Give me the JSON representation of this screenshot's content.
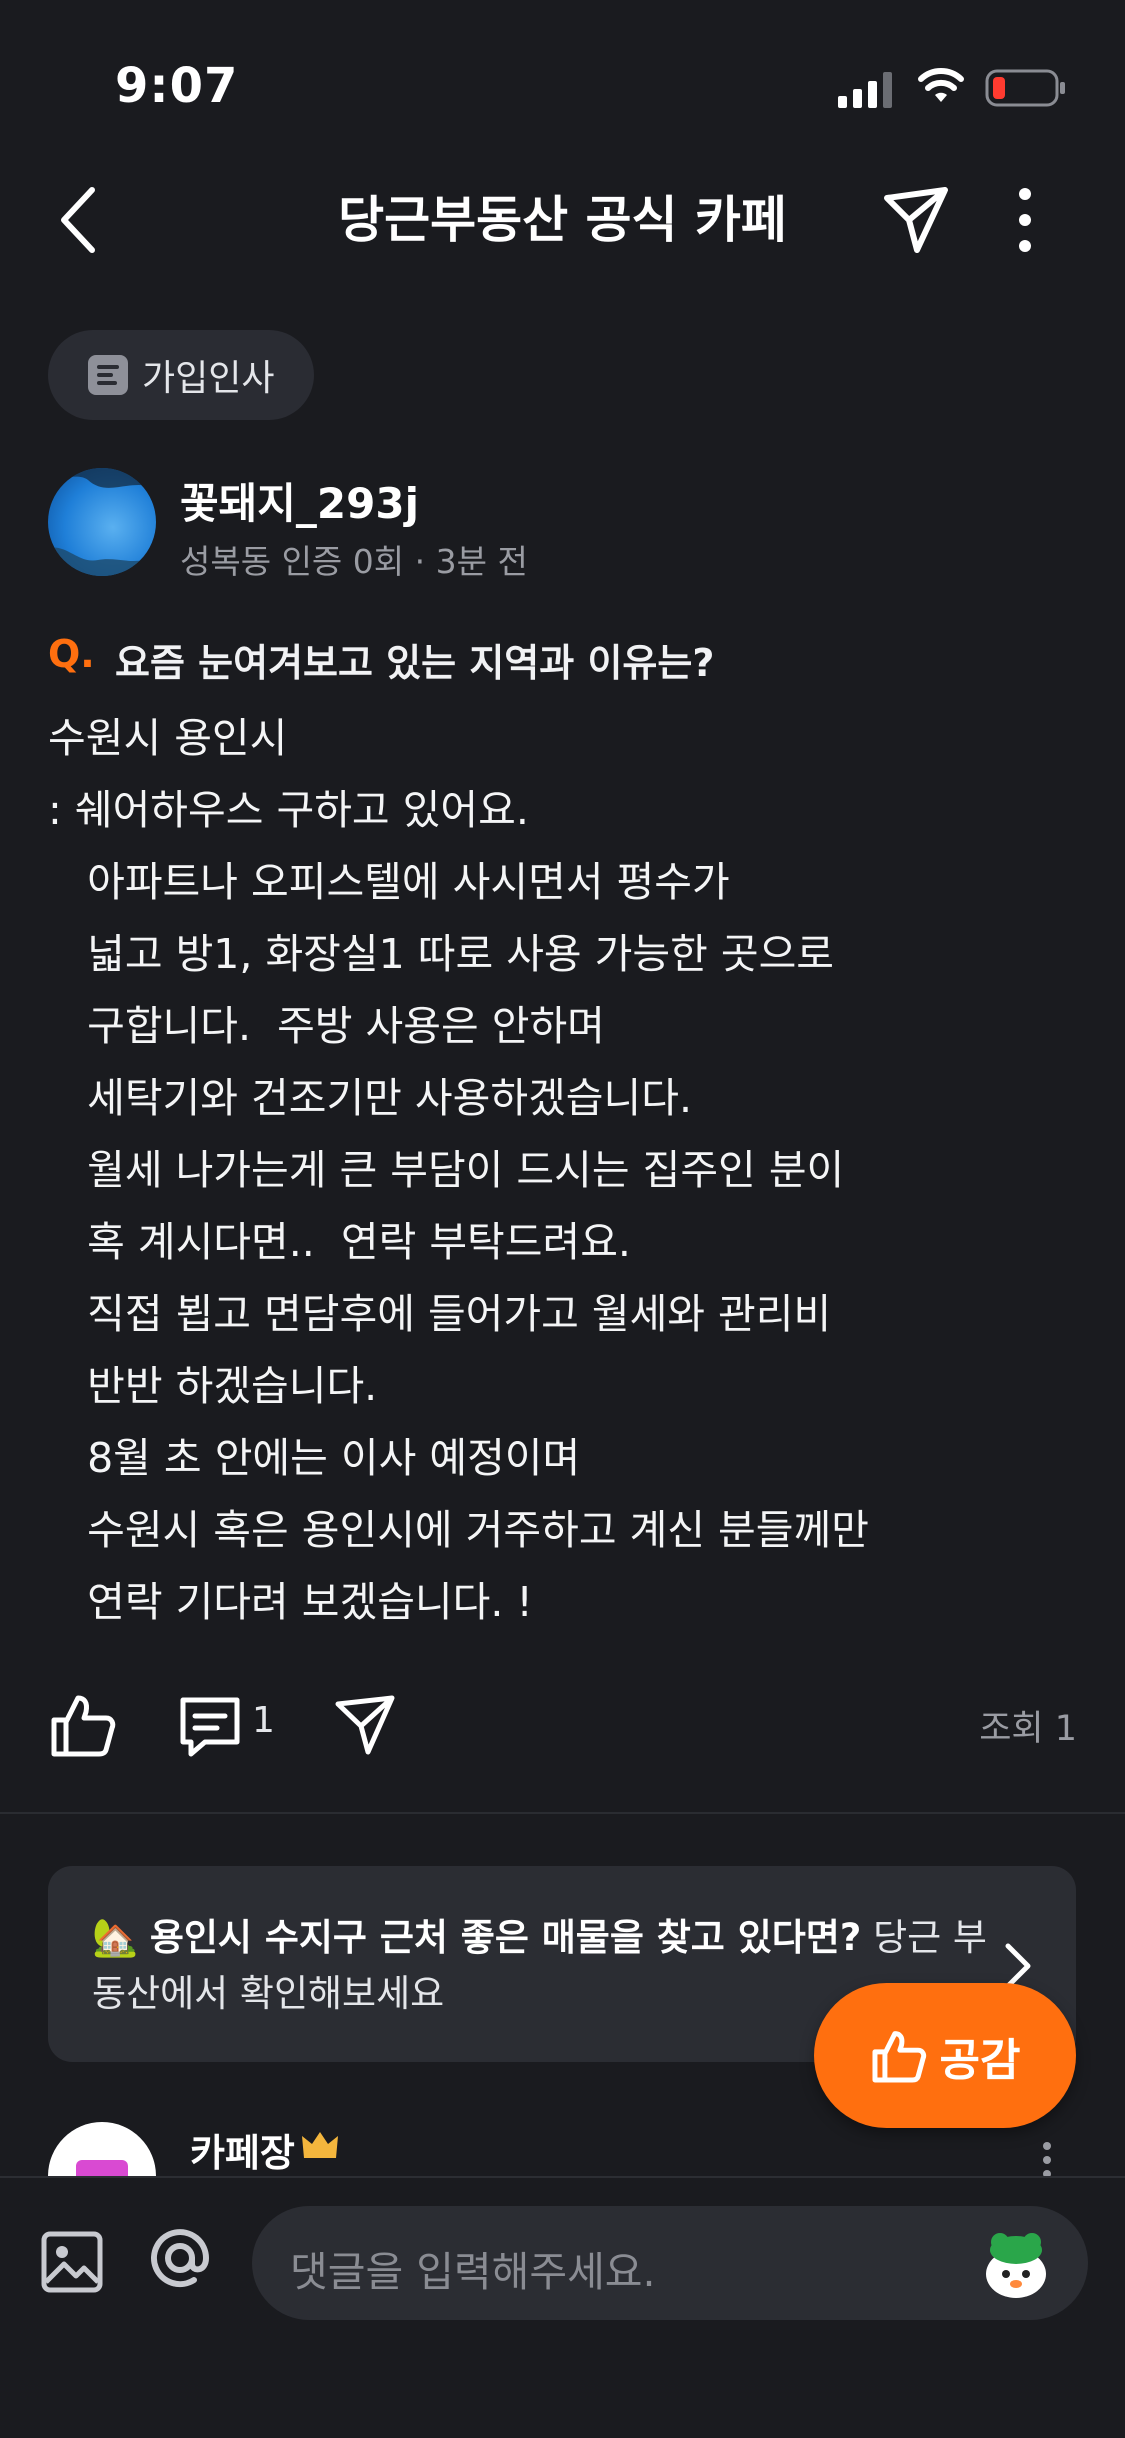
{
  "status_bar": {
    "time": "9:07"
  },
  "header": {
    "title": "당근부동산 공식 카페"
  },
  "category": {
    "label": "가입인사"
  },
  "author": {
    "name": "꽃돼지_293j",
    "meta": "성복동 인증 0회 · 3분 전"
  },
  "question": {
    "mark": "Q.",
    "text": "요즘 눈여겨보고 있는 지역과 이유는?"
  },
  "body": {
    "lines": [
      "수원시 용인시",
      ": 쉐어하우스 구하고 있어요.",
      "   아파트나 오피스텔에 사시면서 평수가",
      "   넓고 방1, 화장실1 따로 사용 가능한 곳으로",
      "   구합니다.  주방 사용은 안하며",
      "   세탁기와 건조기만 사용하겠습니다.",
      "   월세 나가는게 큰 부담이 드시는 집주인 분이",
      "   혹 계시다면..  연락 부탁드려요.",
      "   직접 뵙고 면담후에 들어가고 월세와 관리비",
      "   반반 하겠습니다.",
      "   8월 초 안에는 이사 예정이며",
      "   수원시 혹은 용인시에 거주하고 계신 분들께만",
      "   연락 기다려 보겠습니다. !"
    ]
  },
  "actions": {
    "comment_count": "1",
    "views": "조회 1"
  },
  "promo": {
    "emoji": "🏡",
    "bold_text": "용인시 수지구 근처 좋은 매물을 찾고 있다면?",
    "rest_text": " 당근 부동산에서 확인해보세요"
  },
  "fab": {
    "label": "공감"
  },
  "comment_preview": {
    "name": "카페장"
  },
  "input": {
    "placeholder": "댓글을 입력해주세요."
  },
  "colors": {
    "accent": "#ff6f0f",
    "background": "#1a1b1f",
    "card": "#2b2d33"
  }
}
